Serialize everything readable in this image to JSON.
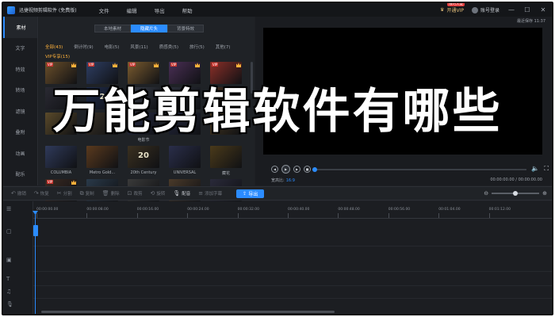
{
  "titlebar": {
    "app_title": "迅捷视频剪辑软件 (免费版)",
    "menu": [
      "文件",
      "编辑",
      "导出",
      "帮助"
    ],
    "vip_label": "开通VIP",
    "vip_badge": "限时大促",
    "login_label": "账号登录",
    "controls": [
      "—",
      "☐",
      "✕"
    ]
  },
  "sidebar": {
    "items": [
      {
        "label": "素材",
        "active": true
      },
      {
        "label": "文字",
        "active": false
      },
      {
        "label": "特效",
        "active": false
      },
      {
        "label": "转场",
        "active": false
      },
      {
        "label": "滤镜",
        "active": false
      },
      {
        "label": "叠附",
        "active": false
      },
      {
        "label": "动画",
        "active": false
      },
      {
        "label": "配乐",
        "active": false
      }
    ]
  },
  "library": {
    "tabs": [
      {
        "label": "本地素材",
        "active": false
      },
      {
        "label": "隐藏片头",
        "active": true
      },
      {
        "label": "背景特效",
        "active": false
      }
    ],
    "categories": [
      {
        "label": "全部(43)",
        "active": true
      },
      {
        "label": "倒计时(9)",
        "active": false
      },
      {
        "label": "电影(5)",
        "active": false
      },
      {
        "label": "风景(11)",
        "active": false
      },
      {
        "label": "质感类(5)",
        "active": false
      },
      {
        "label": "旅行(5)",
        "active": false
      },
      {
        "label": "其他(7)",
        "active": false
      }
    ],
    "vip_section": "VIP专享(15)",
    "thumbs": [
      {
        "label": "",
        "glyph": "",
        "vip": true,
        "color": "#6b4f2a"
      },
      {
        "label": "",
        "glyph": "",
        "vip": true,
        "color": "#2e3e63"
      },
      {
        "label": "",
        "glyph": "",
        "vip": true,
        "color": "#7a5b2f"
      },
      {
        "label": "",
        "glyph": "",
        "vip": true,
        "color": "#4a2f55"
      },
      {
        "label": "",
        "glyph": "",
        "vip": true,
        "color": "#8a2f28"
      },
      {
        "label": "",
        "glyph": "",
        "vip": false,
        "color": "#2a2a33"
      },
      {
        "label": "",
        "glyph": "2",
        "vip": false,
        "color": "#1e2b4a"
      },
      {
        "label": "",
        "glyph": "",
        "vip": false,
        "color": "#3a3f4a"
      },
      {
        "label": "",
        "glyph": "",
        "vip": false,
        "color": "#2b2f3a"
      },
      {
        "label": "",
        "glyph": "",
        "vip": false,
        "color": "#3d2a1e"
      },
      {
        "label": "",
        "glyph": "",
        "vip": false,
        "color": "#5a4a2a"
      },
      {
        "label": "",
        "glyph": "",
        "vip": false,
        "color": "#3a3226"
      },
      {
        "label": "电影节",
        "glyph": "",
        "vip": false,
        "color": "#2a2f4a"
      },
      {
        "label": "",
        "glyph": "",
        "vip": false,
        "color": "#22263a"
      },
      {
        "label": "",
        "glyph": "",
        "vip": false,
        "color": "#4a3a22"
      },
      {
        "label": "COLUMBIA",
        "glyph": "",
        "vip": false,
        "color": "#2f3a5a"
      },
      {
        "label": "Metro Gold...",
        "glyph": "",
        "vip": false,
        "color": "#5a3a1e"
      },
      {
        "label": "20th Century",
        "glyph": "20",
        "vip": false,
        "color": "#3a3020"
      },
      {
        "label": "UNIVERSAL",
        "glyph": "",
        "vip": false,
        "color": "#2a2e4a"
      },
      {
        "label": "藏花",
        "glyph": "",
        "vip": false,
        "color": "#4a3a1a"
      },
      {
        "label": "",
        "glyph": "",
        "vip": true,
        "color": "#3a2a22"
      },
      {
        "label": "",
        "glyph": "",
        "vip": false,
        "color": "#2a3a4a"
      },
      {
        "label": "",
        "glyph": "",
        "vip": false,
        "color": "#3a3a3a"
      },
      {
        "label": "",
        "glyph": "",
        "vip": false,
        "color": "#4a3a2a"
      },
      {
        "label": "",
        "glyph": "",
        "vip": false,
        "color": "#2a2a3a"
      }
    ]
  },
  "preview": {
    "save_time": "最近保存 11:37",
    "ratio_label": "宽高比:",
    "ratio_value": "16:9",
    "timecode": "00:00:00.00 / 00:00:00.00",
    "progress": 0
  },
  "toolbar": {
    "tools": [
      {
        "icon": "↶",
        "label": "撤销",
        "on": false
      },
      {
        "icon": "↷",
        "label": "恢复",
        "on": false
      },
      {
        "icon": "✂",
        "label": "分割",
        "on": false
      },
      {
        "icon": "⧉",
        "label": "复制",
        "on": false
      },
      {
        "icon": "🗑",
        "label": "删除",
        "on": false
      },
      {
        "icon": "⊡",
        "label": "裁剪",
        "on": false
      },
      {
        "icon": "⟲",
        "label": "旋转",
        "on": false
      },
      {
        "icon": "🎙",
        "label": "配音",
        "on": true
      },
      {
        "icon": "≡",
        "label": "添加字幕",
        "on": false
      }
    ],
    "export_label": "导出",
    "zoom_level": 0.5
  },
  "timeline": {
    "ticks": [
      "00:00:00.00",
      "00:00:08.00",
      "00:00:16.00",
      "00:00:24.00",
      "00:00:32.00",
      "00:00:40.00",
      "00:00:48.00",
      "00:00:56.00",
      "00:01:04.00",
      "00:01:12.00"
    ]
  },
  "overlay": {
    "banner_text": "万能剪辑软件有哪些"
  },
  "colors": {
    "accent": "#2b8cff",
    "vip_gold": "#ffb23b"
  }
}
